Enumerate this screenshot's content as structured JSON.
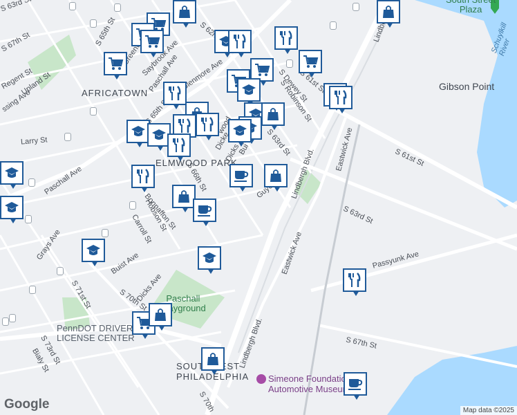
{
  "map": {
    "neighborhoods": [
      {
        "id": "africatown",
        "label": "AFRICATOWN"
      },
      {
        "id": "elmwood",
        "label": "ELMWOOD PARK"
      },
      {
        "id": "southwest",
        "label": "SOUTHWEST\nPHILADELPHIA"
      }
    ],
    "places": [
      {
        "id": "gibson",
        "label": "Gibson Point"
      },
      {
        "id": "plaza",
        "label": "South Street\nPlaza"
      },
      {
        "id": "paschall-playground",
        "label": "Paschall\nPlayground"
      },
      {
        "id": "simeone",
        "label": "Simeone Foundation\nAutomotive Museum"
      },
      {
        "id": "penndot",
        "label": "PennDOT DRIVER\nLICENSE CENTER"
      },
      {
        "id": "river",
        "label": "Schuylkill River"
      }
    ],
    "streets": [
      {
        "id": "s-63rd-top",
        "label": "S 63rd St"
      },
      {
        "id": "s-67th",
        "label": "S 67th St"
      },
      {
        "id": "regent",
        "label": "Regent St"
      },
      {
        "id": "s-65th-a",
        "label": "S 65th St"
      },
      {
        "id": "greenway",
        "label": "Greenway Ave"
      },
      {
        "id": "saybrook",
        "label": "Saybrook Ave"
      },
      {
        "id": "paschall-top",
        "label": "Paschall Ave"
      },
      {
        "id": "glenmore",
        "label": "Glenmore Ave"
      },
      {
        "id": "s-62nd",
        "label": "S 62nd St"
      },
      {
        "id": "s-61st-top",
        "label": "S 61st St"
      },
      {
        "id": "dewey",
        "label": "S Dewey St"
      },
      {
        "id": "robinson",
        "label": "S Robinson St"
      },
      {
        "id": "s-63rd-mid",
        "label": "S 63rd St"
      },
      {
        "id": "upland",
        "label": "Upland St"
      },
      {
        "id": "ssing",
        "label": "ssing Ave"
      },
      {
        "id": "larry",
        "label": "Larry St"
      },
      {
        "id": "paschall-left",
        "label": "Paschall Ave"
      },
      {
        "id": "s-65th-b",
        "label": "S 65th St"
      },
      {
        "id": "dicks-a",
        "label": "Dicks"
      },
      {
        "id": "bui",
        "label": "Bui"
      },
      {
        "id": "s-66th",
        "label": "S 66th St"
      },
      {
        "id": "bonnaffon",
        "label": "Bonnaffon St"
      },
      {
        "id": "hobson",
        "label": "Hobson St"
      },
      {
        "id": "carroll",
        "label": "Carroll St"
      },
      {
        "id": "grays",
        "label": "Grays Ave"
      },
      {
        "id": "buist",
        "label": "Buist Ave"
      },
      {
        "id": "dicks-b",
        "label": "Dicks Ave"
      },
      {
        "id": "s-71st",
        "label": "S 71st St"
      },
      {
        "id": "s-70th",
        "label": "S 70th St"
      },
      {
        "id": "s-73rd",
        "label": "S 73rd St"
      },
      {
        "id": "bialy",
        "label": "Bialy St"
      },
      {
        "id": "lindbergh-top",
        "label": "Lindbergh Blvd"
      },
      {
        "id": "lindbergh-mid",
        "label": "Lindbergh Blvd."
      },
      {
        "id": "lindbergh-bot",
        "label": "Lindbergh Blvd."
      },
      {
        "id": "eastwick-a",
        "label": "Eastwick Ave"
      },
      {
        "id": "eastwick-b",
        "label": "Eastwick Ave"
      },
      {
        "id": "s-61st-right",
        "label": "S 61st St"
      },
      {
        "id": "s-63rd-right",
        "label": "S 63rd St"
      },
      {
        "id": "passyunk",
        "label": "Passyunk Ave"
      },
      {
        "id": "s-67th-right",
        "label": "S 67th St"
      },
      {
        "id": "guye",
        "label": "Guye"
      },
      {
        "id": "s-70th-bot",
        "label": "S 70th"
      },
      {
        "id": "dicke",
        "label": "Dicke"
      },
      {
        "id": "wood",
        "label": "wood"
      }
    ],
    "markers": [
      {
        "type": "shopping-bag"
      },
      {
        "type": "grocery"
      },
      {
        "type": "grocery"
      },
      {
        "type": "grocery"
      },
      {
        "type": "grocery"
      },
      {
        "type": "school"
      },
      {
        "type": "restaurant"
      },
      {
        "type": "restaurant"
      },
      {
        "type": "grocery"
      },
      {
        "type": "grocery"
      },
      {
        "type": "grocery"
      },
      {
        "type": "school"
      },
      {
        "type": "restaurant"
      },
      {
        "type": "restaurant"
      },
      {
        "type": "shopping-bag"
      },
      {
        "type": "restaurant"
      },
      {
        "type": "school"
      },
      {
        "type": "shopping-bag"
      },
      {
        "type": "school"
      },
      {
        "type": "school"
      },
      {
        "type": "restaurant"
      },
      {
        "type": "restaurant"
      },
      {
        "type": "coffee"
      },
      {
        "type": "shopping-bag"
      },
      {
        "type": "school"
      },
      {
        "type": "school"
      },
      {
        "type": "restaurant"
      },
      {
        "type": "restaurant"
      },
      {
        "type": "shopping-bag"
      },
      {
        "type": "coffee"
      },
      {
        "type": "school"
      },
      {
        "type": "school"
      },
      {
        "type": "restaurant"
      },
      {
        "type": "grocery"
      },
      {
        "type": "shopping-bag"
      },
      {
        "type": "shopping-bag"
      },
      {
        "type": "coffee"
      },
      {
        "type": "shopping-bag"
      }
    ],
    "attribution": "Map data ©2025",
    "logo": "Google",
    "colors": {
      "marker_border": "#1f5a99",
      "water": "#aadaff",
      "park": "#c8e6c9",
      "road": "#ffffff"
    }
  }
}
